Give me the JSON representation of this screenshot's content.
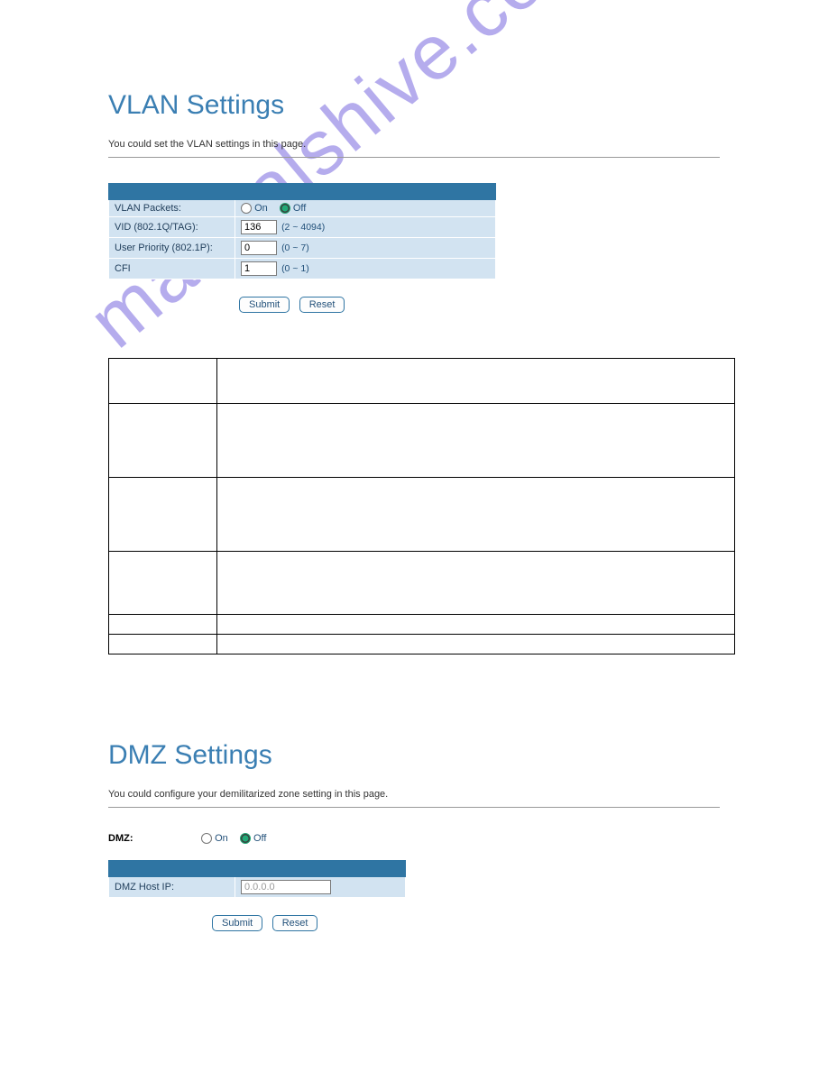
{
  "watermark": "manualshive.com",
  "vlan": {
    "title": "VLAN Settings",
    "desc": "You could set the VLAN settings in this page.",
    "rows": {
      "packets": {
        "label": "VLAN Packets:",
        "on": "On",
        "off": "Off",
        "selected": "off"
      },
      "vid": {
        "label": "VID (802.1Q/TAG):",
        "value": "136",
        "range": "(2 ~ 4094)"
      },
      "priority": {
        "label": "User Priority (802.1P):",
        "value": "0",
        "range": "(0 ~ 7)"
      },
      "cfi": {
        "label": "CFI",
        "value": "1",
        "range": "(0 ~ 1)"
      }
    },
    "submit": "Submit",
    "reset": "Reset"
  },
  "dmz": {
    "title": "DMZ Settings",
    "desc": "You could configure your demilitarized zone setting in this page.",
    "label": "DMZ:",
    "on": "On",
    "off": "Off",
    "selected": "off",
    "hostip_label": "DMZ Host IP:",
    "hostip_value": "0.0.0.0",
    "submit": "Submit",
    "reset": "Reset"
  }
}
